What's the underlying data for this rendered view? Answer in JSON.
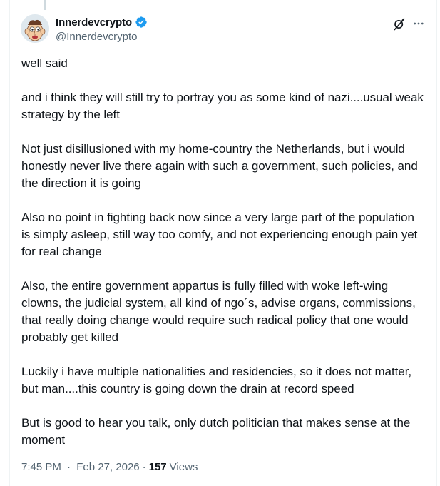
{
  "author": {
    "name": "Innerdevcrypto",
    "handle": "@Innerdevcrypto",
    "verified_color": "#1d9bf0"
  },
  "tweet": {
    "paragraphs": [
      "well said",
      "and i think they will still try to portray you as some kind of nazi....usual weak strategy by the left",
      "Not just disillusioned with my home-country the Netherlands, but i would honestly never live there again with such a government, such policies, and the direction it is going",
      "Also no point in fighting back now since a very large part of the population is simply asleep, still way too comfy, and not experiencing enough pain yet for real change",
      "Also, the entire government appartus is fully filled with woke left-wing clowns, the judicial system, all kind of ngo´s, advise organs, commissions, that really doing change would require such radical policy that one would probably get killed",
      "Luckily i have multiple nationalities and residencies, so it does not matter, but man....this country is going down the drain at record speed",
      "But is good to hear you talk, only dutch politician that makes sense at the moment"
    ]
  },
  "meta": {
    "time": "7:45 PM",
    "separator": "·",
    "date": "Feb 27, 2026",
    "views_count": "157",
    "views_label": "Views"
  },
  "icons": {
    "verified": "verified-badge-icon",
    "grok": "grok-icon",
    "more": "more-options-icon"
  }
}
